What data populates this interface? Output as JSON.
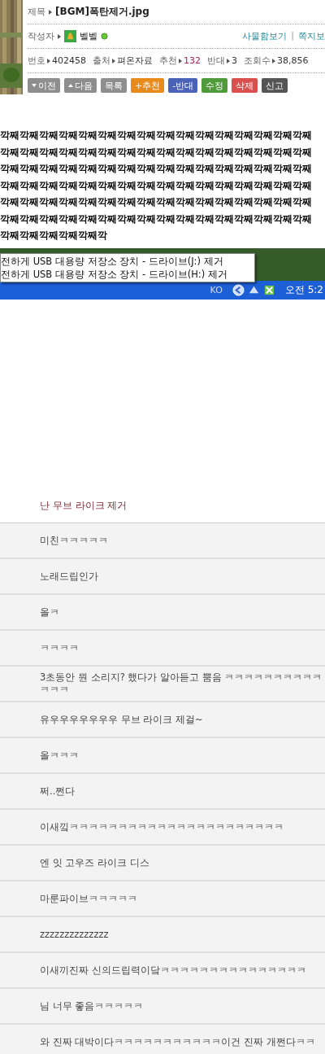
{
  "post": {
    "title_label": "제목",
    "title": "[BGM]폭탄제거.jpg",
    "writer_label": "작성자",
    "writer": "벨벨",
    "writer_online": true,
    "links": [
      {
        "label": "사물함보기"
      },
      {
        "label": "쪽지보"
      }
    ],
    "link_separator": "|",
    "info": [
      {
        "label": "번호",
        "value": "402458",
        "highlight": false
      },
      {
        "label": "출처",
        "value": "펴온자료",
        "highlight": false
      },
      {
        "label": "추천",
        "value": "132",
        "highlight": true
      },
      {
        "label": "반대",
        "value": "3",
        "highlight": false
      },
      {
        "label": "조회수",
        "value": "38,856",
        "highlight": false
      }
    ],
    "buttons": [
      {
        "label": "이전",
        "kind": "prev",
        "color": "#8e8e8e"
      },
      {
        "label": "다음",
        "kind": "next",
        "color": "#8e8e8e"
      },
      {
        "label": "목록",
        "kind": "plain",
        "color": "#8e8e8e"
      },
      {
        "label": "+추천",
        "kind": "plain",
        "color": "#e88a1c"
      },
      {
        "label": "-반대",
        "kind": "plain",
        "color": "#4a62b8"
      },
      {
        "label": "수정",
        "kind": "plain",
        "color": "#4f9a3a"
      },
      {
        "label": "삭제",
        "kind": "plain",
        "color": "#d9504f"
      },
      {
        "label": "신고",
        "kind": "plain",
        "color": "#555555"
      }
    ]
  },
  "body_lines": [
    "깍째깍째깍째깍째깍째깍째깍째깍째깍째깍째깍째깍째깍째깍째깍째깍째",
    "깍째깍째깍째깍째깍째깍째깍째깍째깍째깍째깍째깍째깍째깍째깍째깍째",
    "깍째깍째깍째깍째깍째깍째깍째깍째깍째깍째깍째깍째깍째깍째깍째깍째",
    "깍째깍째깍째깍째깍째깍째깍째깍째깍째깍째깍째깍째깍째깍째깍째깍째",
    "깍째깍째깍째깍째깍째깍째깍째깍째깍째깍째깍째깍째깍째깍째깍째깍째",
    "깍째깍째깍째깍째깍째깍째깍째깍째깍째깍째깍째깍째깍째깍째깍째깍째",
    "깍째깍째깍째깍째깍째깍"
  ],
  "popup_menu": [
    {
      "label": "전하게 USB 대용량 저장소 장치 - 드라이브(J:) 제거"
    },
    {
      "label": "전하게 USB 대용량 저장소 장치 - 드라이브(H:) 제거"
    }
  ],
  "taskbar": {
    "language": "KO",
    "clock": "오전 5:2"
  },
  "comments_title": "난 무브 라이크 제거",
  "comments": [
    "미친ㅋㅋㅋㅋㅋ",
    "노래드립인가",
    "올ㅋ",
    "ㅋㅋㅋㅋ",
    "3초동안 뭔 소리지? 했다가 알아듣고 뿜음 ㅋㅋㅋㅋㅋㅋㅋㅋㅋㅋㅋㅋㅋ",
    "유우우우우우우우 무브 라이크 제걸~",
    "올ㅋㅋㅋ",
    "쩌..쩐다",
    "이새낔ㅋㅋㅋㅋㅋㅋㅋㅋㅋㅋㅋㅋㅋㅋㅋㅋㅋㅋㅋㅋㅋㅋ",
    "엔 잇 고우즈 라이크 디스",
    "마룬파이브ㅋㅋㅋㅋㅋ",
    "zzzzzzzzzzzzzz",
    "이새끼진짜 신의드립력이닼ㅋㅋㅋㅋㅋㅋㅋㅋㅋㅋㅋㅋㅋㅋㅋ",
    "님 너무 좋음ㅋㅋㅋㅋㅋ",
    "와 진짜 대박이다ㅋㅋㅋㅋㅋㅋㅋㅋㅋㅋㅋ이건 진짜 개쩐다ㅋㅋ"
  ]
}
